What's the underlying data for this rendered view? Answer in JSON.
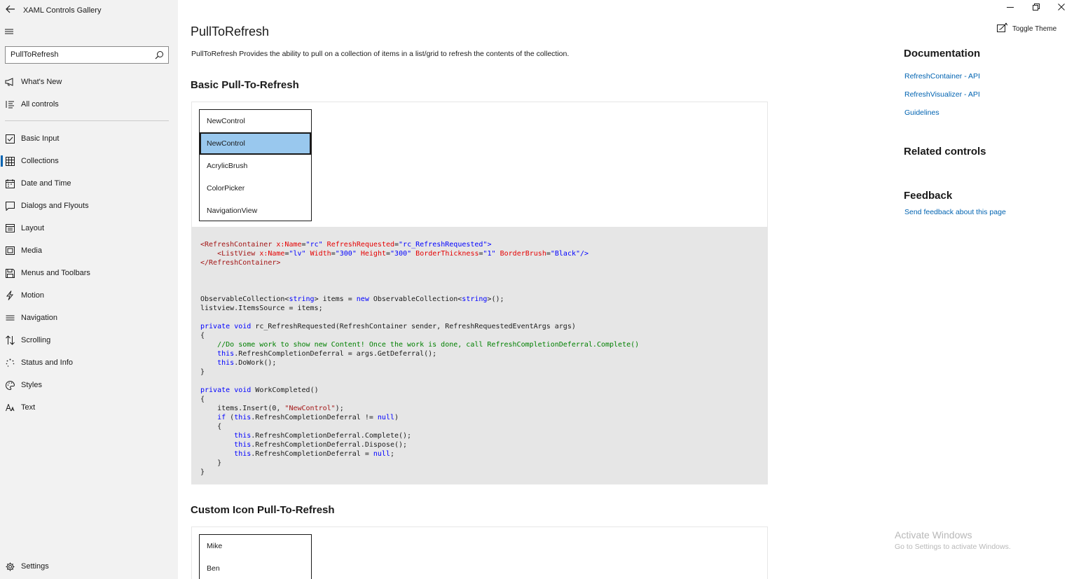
{
  "app": {
    "title": "XAML Controls Gallery"
  },
  "search": {
    "value": "PullToRefresh"
  },
  "nav": {
    "top_items": [
      {
        "label": "What's New",
        "icon": "megaphone-icon"
      },
      {
        "label": "All controls",
        "icon": "list-icon"
      }
    ],
    "items": [
      {
        "label": "Basic Input",
        "icon": "checkbox-icon"
      },
      {
        "label": "Collections",
        "icon": "grid-icon",
        "selected": true
      },
      {
        "label": "Date and Time",
        "icon": "calendar-icon"
      },
      {
        "label": "Dialogs and Flyouts",
        "icon": "chat-icon"
      },
      {
        "label": "Layout",
        "icon": "layout-icon"
      },
      {
        "label": "Media",
        "icon": "media-icon"
      },
      {
        "label": "Menus and Toolbars",
        "icon": "save-icon"
      },
      {
        "label": "Motion",
        "icon": "lightning-icon"
      },
      {
        "label": "Navigation",
        "icon": "navigation-icon"
      },
      {
        "label": "Scrolling",
        "icon": "sort-arrows-icon"
      },
      {
        "label": "Status and Info",
        "icon": "progress-ring-icon"
      },
      {
        "label": "Styles",
        "icon": "palette-icon"
      },
      {
        "label": "Text",
        "icon": "font-icon"
      }
    ],
    "settings_label": "Settings"
  },
  "toolbar": {
    "toggle_theme": "Toggle Theme"
  },
  "main": {
    "title": "PullToRefresh",
    "description": "PullToRefresh Provides the ability to pull on a collection of items in a list/grid to refresh the contents of the collection.",
    "section1": {
      "heading": "Basic Pull-To-Refresh",
      "items": [
        "NewControl",
        "NewControl",
        "AcrylicBrush",
        "ColorPicker",
        "NavigationView"
      ],
      "selected_index": 1
    },
    "section2": {
      "heading": "Custom Icon Pull-To-Refresh",
      "items": [
        "Mike",
        "Ben"
      ]
    }
  },
  "right_panel": {
    "documentation": {
      "heading": "Documentation",
      "links": [
        "RefreshContainer - API",
        "RefreshVisualizer - API",
        "Guidelines"
      ]
    },
    "related": {
      "heading": "Related controls"
    },
    "feedback": {
      "heading": "Feedback",
      "link": "Send feedback about this page"
    }
  },
  "watermark": {
    "line1": "Activate Windows",
    "line2": "Go to Settings to activate Windows."
  },
  "colors": {
    "accent": "#0063b1",
    "selection": "#99c8ee",
    "sidebar_bg": "#f2f2f2",
    "code_bg": "#e6e6e6"
  }
}
